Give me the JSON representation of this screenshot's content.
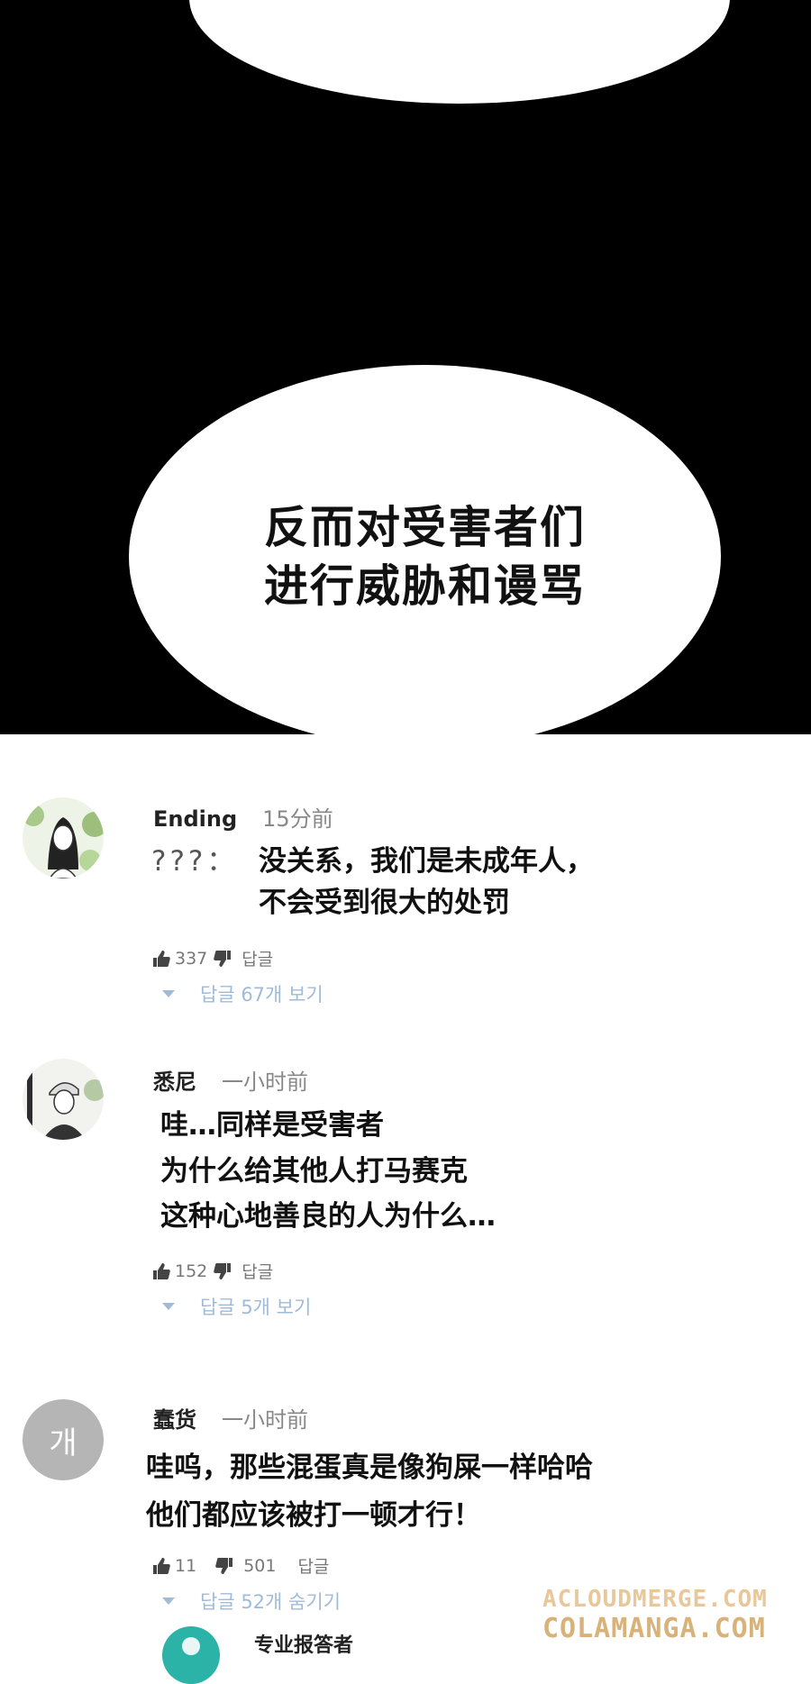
{
  "panel": {
    "bubble_text": [
      "反而对受害者们",
      "进行威胁和谩骂"
    ]
  },
  "comments": [
    {
      "username": "Ending",
      "time": "15分前",
      "prefix": "???：",
      "lines": [
        "没关系，我们是未成年人，",
        "不会受到很大的处罚"
      ],
      "likes": "337",
      "reply_label": "답글",
      "replies_link": "답글 67개 보기"
    },
    {
      "username": "悉尼",
      "time": "一小时前",
      "lines": [
        "哇…同样是受害者",
        "为什么给其他人打马赛克",
        "这种心地善良的人为什么…"
      ],
      "likes": "152",
      "reply_label": "답글",
      "replies_link": "답글 5개 보기"
    },
    {
      "username": "蠢货",
      "avatar_text": "개",
      "time": "一小时前",
      "lines": [
        "哇呜，那些混蛋真是像狗屎一样哈哈",
        "他们都应该被打一顿才行！"
      ],
      "likes": "11",
      "dislikes": "501",
      "reply_label": "답글",
      "replies_link": "답글 52개 숨기기"
    }
  ],
  "partial_reply": {
    "username": "专业报答者"
  },
  "watermark": [
    "ACLOUDMERGE.COM",
    "COLAMANGA.COM"
  ],
  "colors": {
    "panel_bg": "#000000",
    "reply_link": "#9fbbd8",
    "watermark": "#e8c89a",
    "avatar_grey": "#b5b5b5",
    "avatar_teal": "#2bb3a8"
  }
}
